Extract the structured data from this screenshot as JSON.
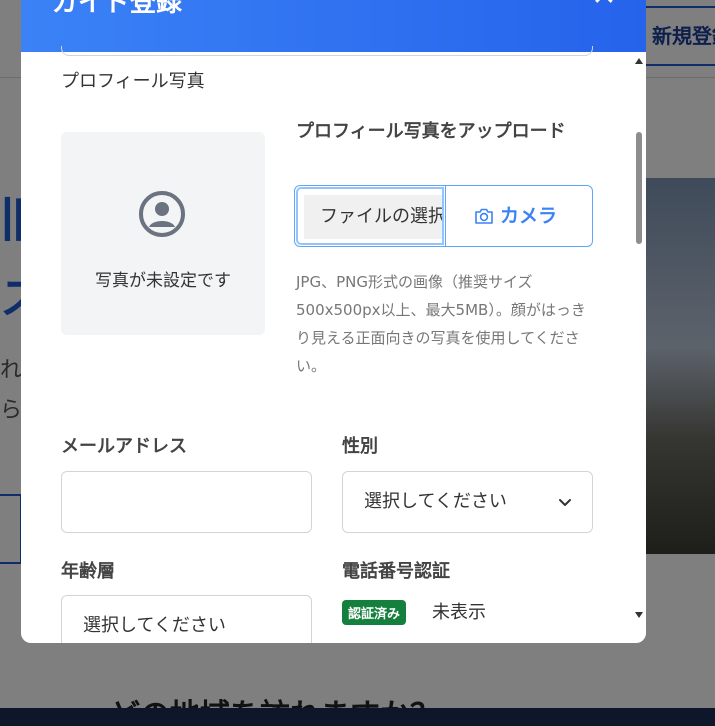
{
  "background": {
    "signup_label": "新規登録",
    "hero_line1": "旧",
    "hero_line2": "ス",
    "text_line1": "れた",
    "text_line2": "られ",
    "bottom_text": "どの地域を訪れますか？"
  },
  "modal": {
    "title": "ガイド登録",
    "close": "✕"
  },
  "profile_photo": {
    "label": "プロフィール写真",
    "empty_text": "写真が未設定です",
    "upload_title": "プロフィール写真をアップロード",
    "file_button": "ファイルの選択",
    "camera_button": "カメラ",
    "help": "JPG、PNG形式の画像（推奨サイズ500x500px以上、最大5MB）。顔がはっきり見える正面向きの写真を使用してください。"
  },
  "email": {
    "label": "メールアドレス",
    "value": ""
  },
  "gender": {
    "label": "性別",
    "selected": "選択してください"
  },
  "age": {
    "label": "年齢層",
    "selected": "選択してください"
  },
  "phone": {
    "label": "電話番号認証",
    "badge": "認証済み",
    "value": "未表示"
  },
  "colors": {
    "primary": "#3b82f6",
    "verified": "#15803d"
  },
  "icons": {
    "avatar": "user-circle-icon",
    "camera": "camera-icon",
    "close": "close-icon",
    "chevron": "chevron-down-icon"
  }
}
